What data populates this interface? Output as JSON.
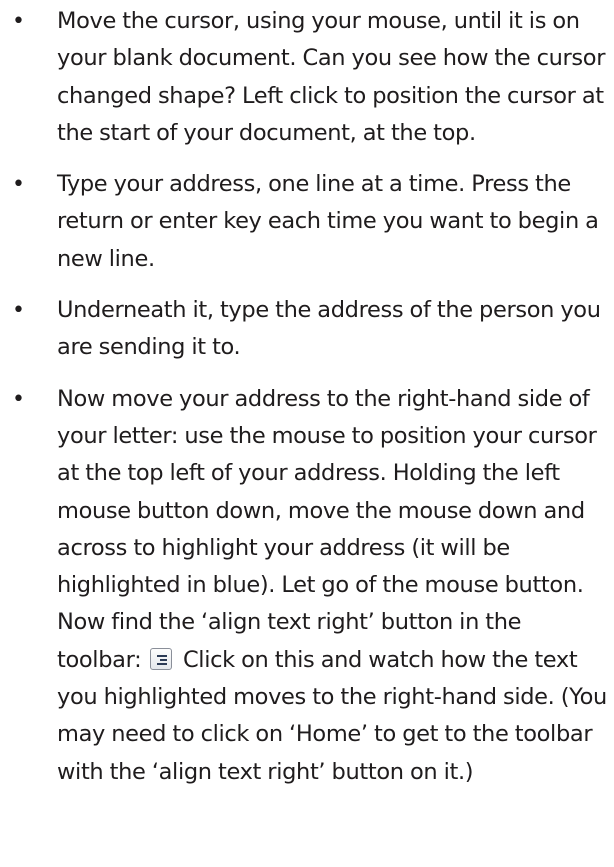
{
  "steps": [
    {
      "bullet": "•",
      "text": "Move the cursor, using your mouse, until it is on your blank document. Can you see how the cursor changed shape? Left click to position the cursor at the start of your document, at the top."
    },
    {
      "bullet": "•",
      "text": "Type your address, one line at a time. Press the return or enter key each time you want to begin a new line."
    },
    {
      "bullet": "•",
      "text": "Underneath it, type the address of the person you are sending it to."
    },
    {
      "bullet": "•",
      "text_before_icon": "Now move your address to the right-hand side of your letter: use the mouse to position your cursor at the top left of your address. Holding the left mouse button down, move the mouse down and across to highlight your address (it will be highlighted in blue). Let go of the mouse button. Now find the ‘align text right’ button in the toolbar:",
      "icon": "align-text-right-icon",
      "text_after_icon": "Click on this and watch how the text you highlighted moves to the right-hand side. (You may need to click on ‘Home’ to get to the toolbar with the ‘align text right’ button on it.)"
    }
  ]
}
